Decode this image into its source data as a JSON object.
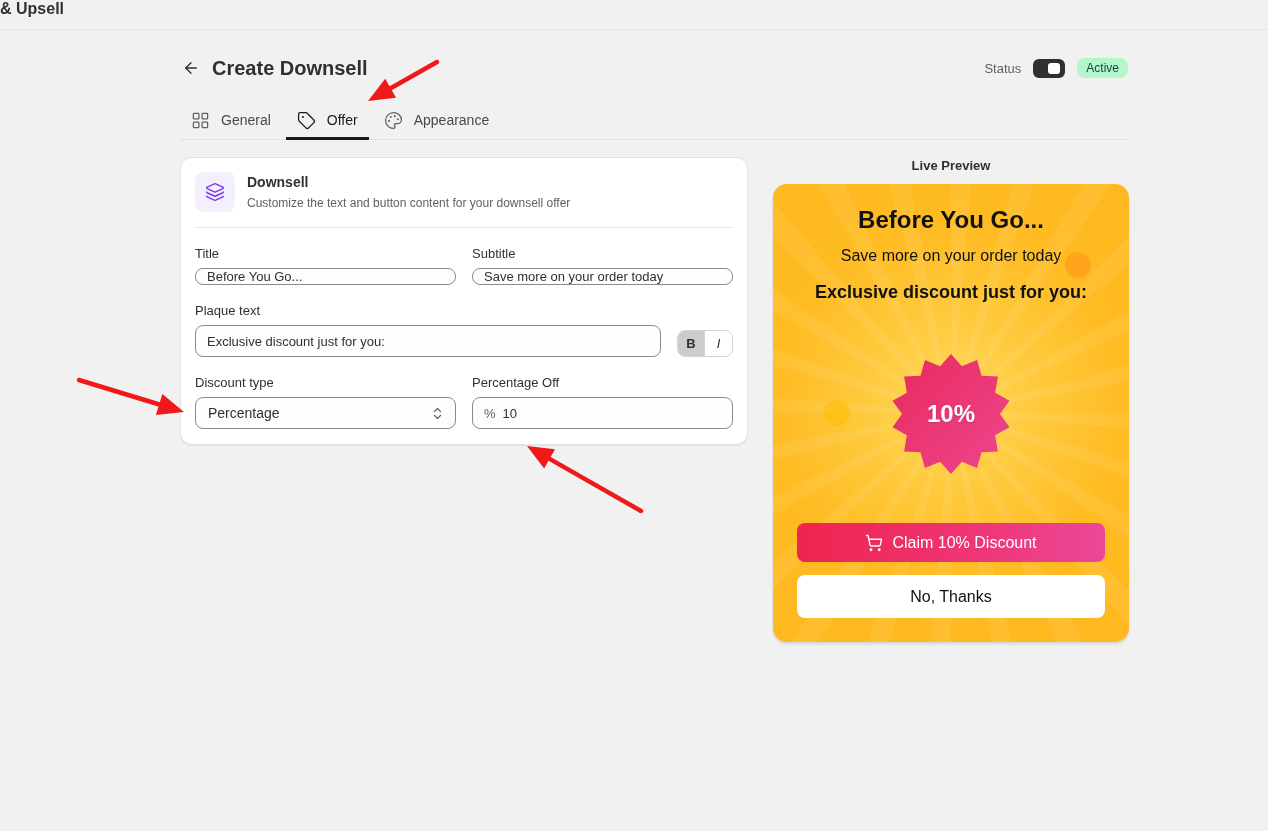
{
  "app_header": {
    "title": "& Upsell"
  },
  "page": {
    "title": "Create Downsell",
    "status": {
      "label": "Status",
      "on": true,
      "badge": "Active"
    }
  },
  "tabs": [
    {
      "label": "General",
      "kind": "grid",
      "selected": false
    },
    {
      "label": "Offer",
      "kind": "tag",
      "selected": true
    },
    {
      "label": "Appearance",
      "kind": "palette",
      "selected": false
    }
  ],
  "section": {
    "title": "Downsell",
    "description": "Customize the text and button content for your downsell offer"
  },
  "fields": [
    {
      "kind": "text",
      "label": "Title",
      "value": "Before You Go..."
    },
    {
      "kind": "text",
      "label": "Subtitle",
      "value": "Save more on your order today"
    },
    {
      "kind": "text",
      "label": "Plaque text",
      "value": "Exclusive discount just for you:",
      "formatting": [
        {
          "kind": "bold",
          "label": "B",
          "selected": true
        },
        {
          "kind": "italic",
          "label": "I",
          "selected": false
        }
      ]
    },
    {
      "kind": "select",
      "label": "Discount type",
      "value": "Percentage"
    },
    {
      "kind": "number",
      "label": "Percentage Off",
      "prefix": "%",
      "value": "10"
    }
  ],
  "preview": {
    "heading": "Live Preview",
    "title": "Before You Go...",
    "subtitle": "Save more on your order today",
    "plaque": "Exclusive discount just for you:",
    "badge": "10%",
    "buttons": [
      {
        "kind": "primary",
        "label": "Claim 10% Discount"
      },
      {
        "kind": "secondary",
        "label": "No, Thanks"
      }
    ]
  }
}
